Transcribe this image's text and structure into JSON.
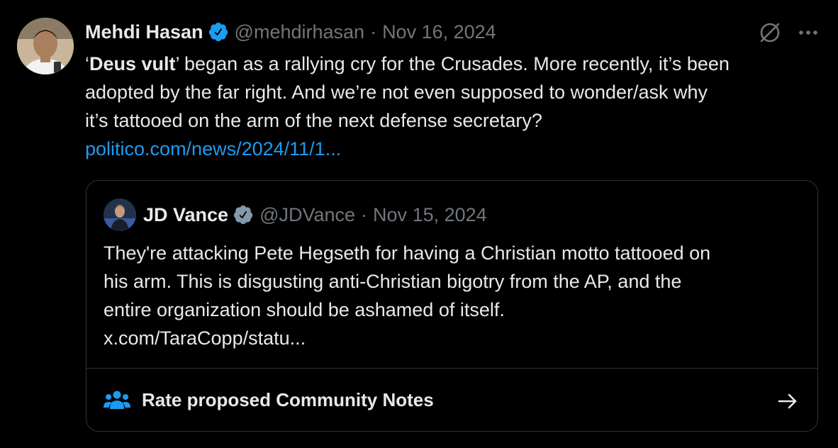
{
  "author": {
    "name": "Mehdi Hasan",
    "handle": "@mehdirhasan",
    "separator": "·",
    "date": "Nov 16, 2024"
  },
  "tweet": {
    "quote_open": "‘",
    "bold_phrase": "Deus vult",
    "quote_close": "’",
    "text_line1_rest": " began as a rallying cry for the Crusades. More recently, it’s been",
    "text_line2": "adopted by the far right. And we’re not even supposed to wonder/ask why",
    "text_line3": "it’s tattooed on the arm of the next defense secretary?",
    "link": "politico.com/news/2024/11/1..."
  },
  "quoted": {
    "name": "JD Vance",
    "handle": "@JDVance",
    "separator": "·",
    "date": "Nov 15, 2024",
    "text_line1": "They're attacking Pete Hegseth for having a Christian motto tattooed on",
    "text_line2": "his arm. This is disgusting anti-Christian bigotry from the AP, and the",
    "text_line3": "entire organization should be ashamed of itself.",
    "text_line4": "x.com/TaraCopp/statu..."
  },
  "community_notes": {
    "label": "Rate proposed Community Notes"
  },
  "icons": {
    "verified": "verified-badge-icon",
    "grok": "grok-icon",
    "more": "more-icon",
    "people": "people-icon",
    "arrow": "arrow-right-icon"
  },
  "colors": {
    "background": "#000000",
    "text": "#e7e9ea",
    "muted": "#71767b",
    "link": "#1d9bf0",
    "border": "#2f3336",
    "verified": "#1d9bf0",
    "verified_gray": "#829aab"
  }
}
